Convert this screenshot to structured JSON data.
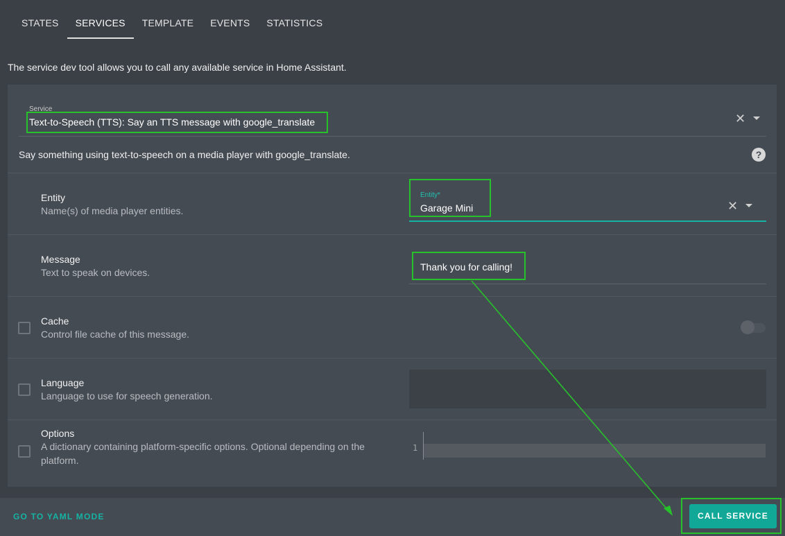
{
  "tabs": [
    {
      "label": "STATES"
    },
    {
      "label": "SERVICES",
      "active": true
    },
    {
      "label": "TEMPLATE"
    },
    {
      "label": "EVENTS"
    },
    {
      "label": "STATISTICS"
    }
  ],
  "intro": "The service dev tool allows you to call any available service in Home Assistant.",
  "service": {
    "label": "Service",
    "value": "Text-to-Speech (TTS): Say an TTS message with google_translate",
    "description": "Say something using text-to-speech on a media player with google_translate.",
    "clear_icon": "close-icon",
    "dropdown_icon": "caret-down-icon",
    "help_icon": "help-circle-icon"
  },
  "fields": {
    "entity": {
      "title": "Entity",
      "subtitle": "Name(s) of media player entities.",
      "label": "Entity*",
      "value": "Garage Mini"
    },
    "message": {
      "title": "Message",
      "subtitle": "Text to speak on devices.",
      "value": "Thank you for calling!"
    },
    "cache": {
      "title": "Cache",
      "subtitle": "Control file cache of this message.",
      "enabled": false
    },
    "language": {
      "title": "Language",
      "subtitle": "Language to use for speech generation.",
      "value": ""
    },
    "options": {
      "title": "Options",
      "subtitle": "A dictionary containing platform-specific options. Optional depending on the platform.",
      "line_number": "1"
    }
  },
  "footer": {
    "yaml_mode": "GO TO YAML MODE",
    "call_service": "CALL SERVICE"
  },
  "colors": {
    "background": "#3b4047",
    "card": "#454b53",
    "accent": "#15b3a3",
    "annotation": "#27c22b"
  }
}
